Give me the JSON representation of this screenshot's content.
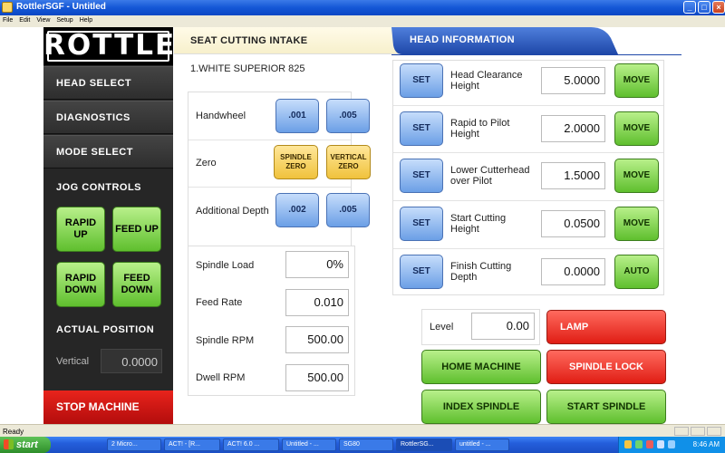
{
  "window": {
    "title": "RottlerSGF - Untitled",
    "buttons": {
      "minimize": "_",
      "maximize": "□",
      "close": "×"
    }
  },
  "menu": [
    "File",
    "Edit",
    "View",
    "Setup",
    "Help"
  ],
  "sidebar": {
    "logo": "ROTTLER",
    "nav": [
      "HEAD SELECT",
      "DIAGNOSTICS",
      "MODE SELECT"
    ],
    "jog_title": "JOG CONTROLS",
    "jog": {
      "rapid_up": "RAPID UP",
      "feed_up": "FEED UP",
      "rapid_down": "RAPID DOWN",
      "feed_down": "FEED DOWN"
    },
    "position_title": "ACTUAL POSITION",
    "vertical_label": "Vertical",
    "vertical_value": "0.0000",
    "stop": "STOP MACHINE"
  },
  "tabs": {
    "seat": "SEAT CUTTING INTAKE",
    "head": "HEAD INFORMATION"
  },
  "seat": {
    "job_name": "1.WHITE SUPERIOR 825",
    "handwheel": {
      "label": "Handwheel",
      "b1": ".001",
      "b2": ".005"
    },
    "zero": {
      "label": "Zero",
      "spindle": "SPINDLE ZERO",
      "vertical": "VERTICAL ZERO"
    },
    "additional_depth": {
      "label": "Additional Depth",
      "b1": ".002",
      "b2": ".005"
    },
    "readouts": [
      {
        "label": "Spindle Load",
        "value": "0%"
      },
      {
        "label": "Feed Rate",
        "value": "0.010"
      },
      {
        "label": "Spindle RPM",
        "value": "500.00"
      },
      {
        "label": "Dwell RPM",
        "value": "500.00"
      }
    ]
  },
  "head": {
    "rows": [
      {
        "set": "SET",
        "label": "Head Clearance Height",
        "value": "5.0000",
        "action": "MOVE"
      },
      {
        "set": "SET",
        "label": "Rapid to Pilot  Height",
        "value": "2.0000",
        "action": "MOVE"
      },
      {
        "set": "SET",
        "label": "Lower Cutterhead over Pilot",
        "value": "1.5000",
        "action": "MOVE"
      },
      {
        "set": "SET",
        "label": "Start Cutting Height",
        "value": "0.0500",
        "action": "MOVE"
      },
      {
        "set": "SET",
        "label": "Finish Cutting Depth",
        "value": "0.0000",
        "action": "AUTO"
      }
    ],
    "level_label": "Level",
    "level_value": "0.00"
  },
  "actions": {
    "lamp": "LAMP",
    "home_machine": "HOME MACHINE",
    "spindle_lock": "SPINDLE LOCK",
    "index_spindle": "INDEX SPINDLE",
    "start_spindle": "START SPINDLE"
  },
  "status": {
    "text": "Ready"
  },
  "taskbar": {
    "start": "start",
    "tasks": [
      "2 Micro...",
      "ACT! - [R...",
      "ACT! 6.0 ...",
      "Untitled - ...",
      "SG80",
      "RottlerSG...",
      "untitled - ..."
    ],
    "clock": "8:46 AM"
  },
  "colors": {
    "accent_blue": "#2c5cc5",
    "green": "#5fbf2e",
    "red": "#e01d14",
    "yellow": "#f0c23c"
  }
}
